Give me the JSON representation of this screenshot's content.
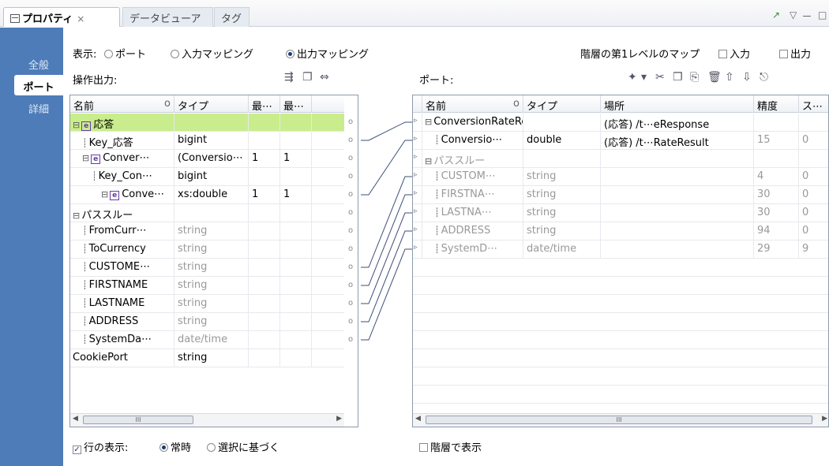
{
  "tabs": [
    {
      "label": "プロパティ",
      "close": "×"
    },
    {
      "label": "データビューア"
    },
    {
      "label": "タグ"
    }
  ],
  "window_controls": {
    "new": "↗",
    "menu": "▽",
    "min": "ー",
    "max": "□"
  },
  "side_tabs": [
    "全般",
    "ポート",
    "詳細"
  ],
  "display": {
    "label": "表示:",
    "options": [
      "ポート",
      "入力マッピング",
      "出力マッピング"
    ],
    "selected": "出力マッピング"
  },
  "hier_map": {
    "label": "階層の第1レベルのマップ",
    "input": "入力",
    "output": "出力"
  },
  "left_panel": {
    "title": "操作出力:",
    "columns": [
      "名前",
      "タイプ",
      "最⋯",
      "最⋯"
    ],
    "rows": [
      {
        "name": "応答",
        "type": "",
        "c3": "",
        "c4": ""
      },
      {
        "name": "Key_応答",
        "type": "bigint",
        "c3": "",
        "c4": ""
      },
      {
        "name": "Conver⋯",
        "type": "(Conversio⋯",
        "c3": "1",
        "c4": "1"
      },
      {
        "name": "Key_Con⋯",
        "type": "bigint",
        "c3": "",
        "c4": ""
      },
      {
        "name": "Conve⋯",
        "type": "xs:double",
        "c3": "1",
        "c4": "1"
      },
      {
        "name": "パススルー",
        "type": "",
        "c3": "",
        "c4": ""
      },
      {
        "name": "FromCurr⋯",
        "type": "string",
        "c3": "",
        "c4": ""
      },
      {
        "name": "ToCurrency",
        "type": "string",
        "c3": "",
        "c4": ""
      },
      {
        "name": "CUSTOME⋯",
        "type": "string",
        "c3": "",
        "c4": ""
      },
      {
        "name": "FIRSTNAME",
        "type": "string",
        "c3": "",
        "c4": ""
      },
      {
        "name": "LASTNAME",
        "type": "string",
        "c3": "",
        "c4": ""
      },
      {
        "name": "ADDRESS",
        "type": "string",
        "c3": "",
        "c4": ""
      },
      {
        "name": "SystemDa⋯",
        "type": "date/time",
        "c3": "",
        "c4": ""
      },
      {
        "name": "CookiePort",
        "type": "string",
        "c3": "",
        "c4": ""
      }
    ],
    "scroll_glyph": "III"
  },
  "right_panel": {
    "title": "ポート:",
    "columns": [
      "名前",
      "タイプ",
      "場所",
      "精度",
      "ス⋯"
    ],
    "rows": [
      {
        "name": "ConversionRateResponse",
        "type": "",
        "loc": "(応答) /t⋯eResponse",
        "prec": "",
        "scale": ""
      },
      {
        "name": "Conversio⋯",
        "type": "double",
        "loc": "(応答) /t⋯RateResult",
        "prec": "15",
        "scale": "0"
      },
      {
        "name": "パススルー",
        "type": "",
        "loc": "",
        "prec": "",
        "scale": ""
      },
      {
        "name": "CUSTOM⋯",
        "type": "string",
        "loc": "",
        "prec": "4",
        "scale": "0"
      },
      {
        "name": "FIRSTNA⋯",
        "type": "string",
        "loc": "",
        "prec": "30",
        "scale": "0"
      },
      {
        "name": "LASTNA⋯",
        "type": "string",
        "loc": "",
        "prec": "30",
        "scale": "0"
      },
      {
        "name": "ADDRESS",
        "type": "string",
        "loc": "",
        "prec": "94",
        "scale": "0"
      },
      {
        "name": "SystemD⋯",
        "type": "date/time",
        "loc": "",
        "prec": "29",
        "scale": "9"
      }
    ],
    "scroll_glyph": "III"
  },
  "bottom": {
    "show_rows": "行の表示:",
    "always": "常時",
    "by_selection": "選択に基づく",
    "hier_display": "階層で表示"
  }
}
